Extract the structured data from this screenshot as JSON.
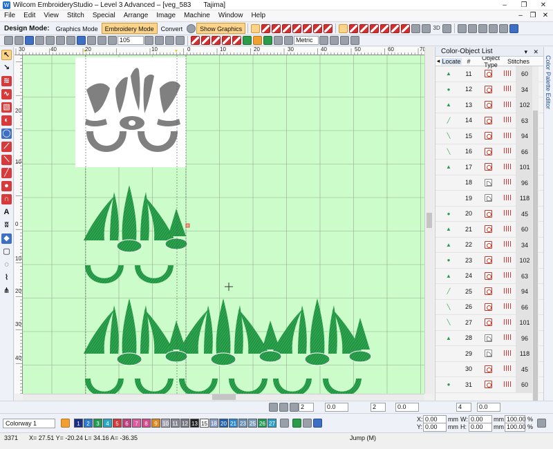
{
  "window": {
    "title": "Wilcom EmbroideryStudio – Level 3 Advanced – [veg_583",
    "machine": "Tajima]",
    "controls": [
      "–",
      "❐",
      "✕"
    ],
    "mdi_controls": [
      "–",
      "❐",
      "✕"
    ]
  },
  "menu": [
    "File",
    "Edit",
    "View",
    "Stitch",
    "Special",
    "Arrange",
    "Image",
    "Machine",
    "Window",
    "Help"
  ],
  "toolbar": {
    "design_mode_label": "Design Mode:",
    "graphics_mode": "Graphics Mode",
    "embroidery_mode": "Embroidery Mode",
    "convert": "Convert",
    "show_graphics": "Show Graphics",
    "zoom_value": "105",
    "units": "Metric",
    "threed": "3D"
  },
  "rulers": {
    "top_labels": [
      "30",
      "40",
      "20",
      "10",
      "0",
      "10",
      "20",
      "30",
      "40",
      "50",
      "60",
      "70"
    ],
    "left_labels": [
      "20",
      "10",
      "0",
      "10",
      "20",
      "30",
      "40"
    ]
  },
  "panel": {
    "title": "Color-Object List",
    "side_tab": "Color Palette Editor",
    "columns": [
      "Locate",
      "#",
      "Object Type",
      "Stitches"
    ],
    "rows": [
      {
        "num": "11",
        "type": "fill",
        "stitches": "60"
      },
      {
        "num": "12",
        "type": "fill",
        "stitches": "34"
      },
      {
        "num": "13",
        "type": "fill",
        "stitches": "102"
      },
      {
        "num": "14",
        "type": "fill",
        "stitches": "63"
      },
      {
        "num": "15",
        "type": "fill",
        "stitches": "94"
      },
      {
        "num": "16",
        "type": "fill",
        "stitches": "66"
      },
      {
        "num": "17",
        "type": "fill",
        "stitches": "101"
      },
      {
        "num": "18",
        "type": "curve",
        "stitches": "96"
      },
      {
        "num": "19",
        "type": "curve",
        "stitches": "118"
      },
      {
        "num": "20",
        "type": "fill",
        "stitches": "45"
      },
      {
        "num": "21",
        "type": "fill",
        "stitches": "60"
      },
      {
        "num": "22",
        "type": "fill",
        "stitches": "34"
      },
      {
        "num": "23",
        "type": "fill",
        "stitches": "102"
      },
      {
        "num": "24",
        "type": "fill",
        "stitches": "63"
      },
      {
        "num": "25",
        "type": "fill",
        "stitches": "94"
      },
      {
        "num": "26",
        "type": "fill",
        "stitches": "66"
      },
      {
        "num": "27",
        "type": "fill",
        "stitches": "101"
      },
      {
        "num": "28",
        "type": "curve",
        "stitches": "96"
      },
      {
        "num": "29",
        "type": "curve",
        "stitches": "118"
      },
      {
        "num": "30",
        "type": "fill",
        "stitches": "45"
      },
      {
        "num": "31",
        "type": "fill",
        "stitches": "60"
      }
    ]
  },
  "bottom": {
    "spin_a": "2",
    "spin_b": "0.0",
    "spin_c": "2",
    "spin_d": "0.0",
    "spin_e": "4",
    "spin_f": "0.0",
    "colorway": "Colorway 1",
    "swatches": [
      {
        "n": "1",
        "c": "#1a2f8a"
      },
      {
        "n": "2",
        "c": "#2a7bd4"
      },
      {
        "n": "3",
        "c": "#1d9c52"
      },
      {
        "n": "4",
        "c": "#2aa7c4"
      },
      {
        "n": "5",
        "c": "#d33a3a"
      },
      {
        "n": "6",
        "c": "#c2407f"
      },
      {
        "n": "7",
        "c": "#e05aa0"
      },
      {
        "n": "8",
        "c": "#d94a8c"
      },
      {
        "n": "9",
        "c": "#e0891f"
      },
      {
        "n": "10",
        "c": "#a5a5b5"
      },
      {
        "n": "11",
        "c": "#8a8a96"
      },
      {
        "n": "12",
        "c": "#7a7a86"
      },
      {
        "n": "13",
        "c": "#222222"
      },
      {
        "n": "15",
        "c": "#ffffff"
      },
      {
        "n": "18",
        "c": "#8aa0c8"
      },
      {
        "n": "20",
        "c": "#1d5fb0"
      },
      {
        "n": "21",
        "c": "#2a88d4"
      },
      {
        "n": "23",
        "c": "#6a8fb8"
      },
      {
        "n": "25",
        "c": "#7fa0c0"
      },
      {
        "n": "26",
        "c": "#1d9c52"
      },
      {
        "n": "27",
        "c": "#2a9fc8"
      }
    ],
    "x_label": "X:",
    "x_value": "0.00",
    "x_unit": "mm",
    "y_label": "Y:",
    "y_value": "0.00",
    "y_unit": "mm",
    "w_label": "W:",
    "w_value": "0.00",
    "w_unit": "mm",
    "h_label": "H:",
    "h_value": "0.00",
    "h_unit": "mm",
    "w_pct": "100.00",
    "h_pct": "100.00",
    "pct": "%"
  },
  "status": {
    "stitch_count": "3371",
    "coords": "X= 27.51 Y= -20.24 L= 34.16 A= -36.35",
    "mode": "Jump (M)"
  },
  "colors": {
    "canvas": "#ccfcc9",
    "stitch_green": "#27a04a",
    "graphic_gray": "#808080",
    "highlight": "#fbd38a"
  }
}
